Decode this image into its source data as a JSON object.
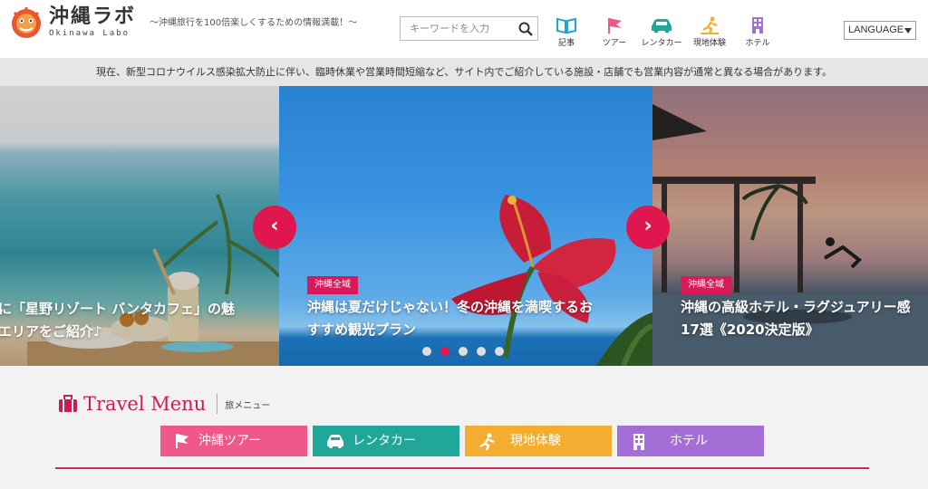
{
  "site": {
    "logo_title": "沖縄ラボ",
    "logo_sub": "Okinawa Labo",
    "tagline": "〜沖縄旅行を100倍楽しくするための情報満載！〜"
  },
  "search": {
    "placeholder": "キーワードを入力",
    "value": ""
  },
  "nav": [
    {
      "label": "記事",
      "icon": "book-icon"
    },
    {
      "label": "ツアー",
      "icon": "flag-icon"
    },
    {
      "label": "レンタカー",
      "icon": "car-icon"
    },
    {
      "label": "現地体験",
      "icon": "activity-icon"
    },
    {
      "label": "ホテル",
      "icon": "hotel-icon"
    }
  ],
  "language": {
    "label": "LANGUAGE"
  },
  "notice": "現在、新型コロナウイルス感染拡大防止に伴い、臨時休業や営業時間短縮など、サイト内でご紹介している施設・店舗でも営業内容が通常と異なる場合があります。",
  "slides": [
    {
      "title_line1": "に「星野リゾート バンタカフェ」の魅",
      "title_line2": "エリアをご紹介♪"
    },
    {
      "tag": "沖縄全域",
      "title_line1": "沖縄は夏だけじゃない！冬の沖縄を満喫するお",
      "title_line2": "すすめ観光プラン"
    },
    {
      "tag": "沖縄全域",
      "title_line1": "沖縄の高級ホテル・ラグジュアリー感",
      "title_line2": "17選《2020決定版》"
    }
  ],
  "slider": {
    "prev": "‹",
    "next": "›",
    "dot_count": 5,
    "active_dot": 1
  },
  "travel_menu": {
    "title": "Travel Menu",
    "subtitle": "旅メニュー",
    "buttons": [
      {
        "label": "沖縄ツアー",
        "color": "#f0578a",
        "icon": "flag-icon"
      },
      {
        "label": "レンタカー",
        "color": "#21a79a",
        "icon": "car-icon"
      },
      {
        "label": "現地体験",
        "color": "#f3ae32",
        "icon": "activity-icon"
      },
      {
        "label": "ホテル",
        "color": "#a36fd6",
        "icon": "hotel-icon"
      }
    ]
  },
  "colors": {
    "accent": "#e0174f",
    "tag": "#d9195a",
    "rule": "#d3265a"
  }
}
